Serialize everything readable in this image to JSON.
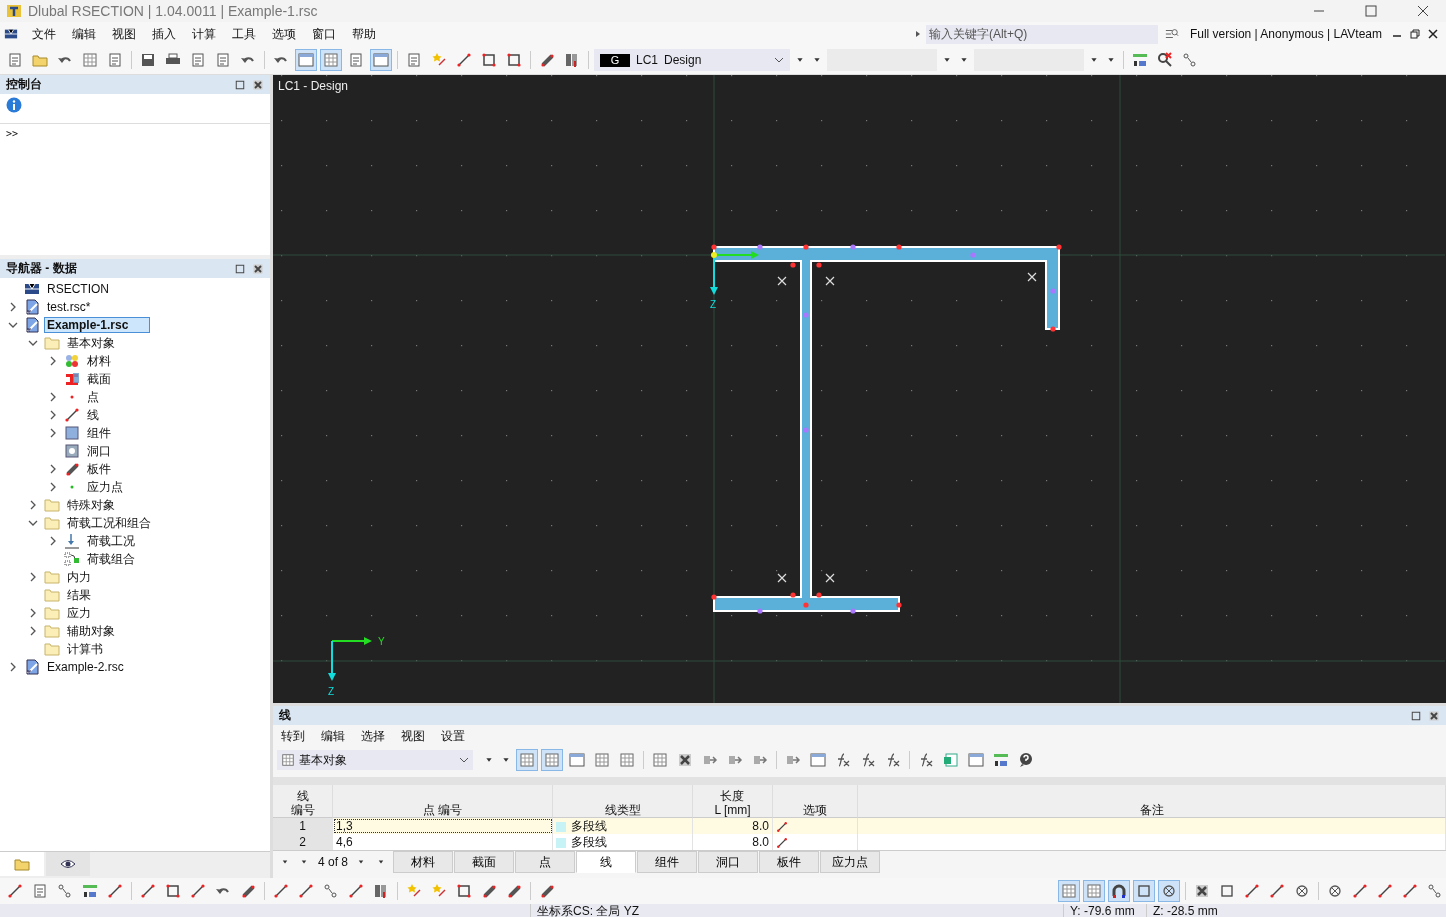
{
  "window": {
    "title": "Dlubal RSECTION | 1.04.0011 | Example-1.rsc"
  },
  "menu": [
    "文件",
    "编辑",
    "视图",
    "插入",
    "计算",
    "工具",
    "选项",
    "窗口",
    "帮助"
  ],
  "search": {
    "placeholder": "输入关键字(Alt+Q)"
  },
  "license": "Full version | Anonymous | LAVteam",
  "load_case": {
    "badge": "G",
    "id": "LC1",
    "name": "Design"
  },
  "console": {
    "title": "控制台",
    "prompt": ">>"
  },
  "navigator": {
    "title": "导航器 - 数据",
    "tree": [
      {
        "label": "RSECTION",
        "kind": "root",
        "selected": false
      },
      {
        "label": "test.rsc*",
        "kind": "file",
        "expanded": false,
        "selected": false
      },
      {
        "label": "Example-1.rsc",
        "kind": "file",
        "expanded": true,
        "selected": true,
        "children": [
          {
            "label": "基本对象",
            "kind": "folder",
            "expanded": true,
            "selected": false,
            "children": [
              {
                "label": "材料",
                "kind": "material",
                "expanded": false,
                "selected": false
              },
              {
                "label": "截面",
                "kind": "section",
                "selected": false
              },
              {
                "label": "点",
                "kind": "point",
                "expanded": false,
                "selected": false
              },
              {
                "label": "线",
                "kind": "line",
                "expanded": false,
                "selected": false
              },
              {
                "label": "组件",
                "kind": "part",
                "expanded": false,
                "selected": false
              },
              {
                "label": "洞口",
                "kind": "opening",
                "selected": false
              },
              {
                "label": "板件",
                "kind": "plate",
                "expanded": false,
                "selected": false
              },
              {
                "label": "应力点",
                "kind": "stress-point",
                "expanded": false,
                "selected": false
              }
            ]
          },
          {
            "label": "特殊对象",
            "kind": "folder",
            "expanded": false,
            "selected": false
          },
          {
            "label": "荷载工况和组合",
            "kind": "folder",
            "expanded": true,
            "selected": false,
            "children": [
              {
                "label": "荷载工况",
                "kind": "load-case",
                "expanded": false,
                "selected": false
              },
              {
                "label": "荷载组合",
                "kind": "combination",
                "selected": false
              }
            ]
          },
          {
            "label": "内力",
            "kind": "folder",
            "expanded": false,
            "selected": false
          },
          {
            "label": "结果",
            "kind": "folder",
            "selected": false
          },
          {
            "label": "应力",
            "kind": "folder",
            "expanded": false,
            "selected": false
          },
          {
            "label": "辅助对象",
            "kind": "folder",
            "expanded": false,
            "selected": false
          },
          {
            "label": "计算书",
            "kind": "folder",
            "selected": false
          }
        ]
      },
      {
        "label": "Example-2.rsc",
        "kind": "file",
        "expanded": false,
        "selected": false
      }
    ],
    "tabs": [
      {
        "selected": true
      },
      {
        "selected": false
      }
    ]
  },
  "viewport": {
    "label": "LC1 - Design",
    "axis_labels": [
      "Z",
      "Y",
      "Z"
    ]
  },
  "table_panel": {
    "title": "线",
    "menu": [
      "转到",
      "编辑",
      "选择",
      "视图",
      "设置"
    ],
    "filter": "基本对象",
    "columns": [
      {
        "lines": [
          "线",
          "编号"
        ]
      },
      {
        "lines": [
          "点 编号"
        ]
      },
      {
        "lines": [
          "线类型"
        ]
      },
      {
        "lines": [
          "长度",
          "L [mm]"
        ]
      },
      {
        "lines": [
          "选项"
        ]
      },
      {
        "lines": [
          "备注"
        ]
      }
    ],
    "rows": [
      {
        "number": "1",
        "points": "1,3",
        "type": "多段线",
        "length": "8.0",
        "selected": true
      },
      {
        "number": "2",
        "points": "4,6",
        "type": "多段线",
        "length": "8.0",
        "selected": false
      }
    ],
    "pager": "4 of 8",
    "tabs": [
      {
        "label": "材料",
        "selected": false
      },
      {
        "label": "截面",
        "selected": false
      },
      {
        "label": "点",
        "selected": false
      },
      {
        "label": "线",
        "selected": true
      },
      {
        "label": "组件",
        "selected": false
      },
      {
        "label": "洞口",
        "selected": false
      },
      {
        "label": "板件",
        "selected": false
      },
      {
        "label": "应力点",
        "selected": false
      }
    ]
  },
  "status_bar": {
    "coordinate_system": "坐标系CS: 全局 YZ",
    "y": "Y: -79.6 mm",
    "z": "Z: -28.5 mm"
  }
}
